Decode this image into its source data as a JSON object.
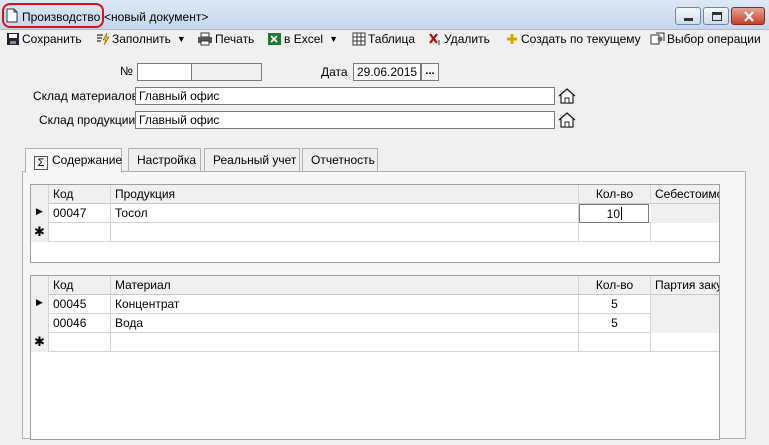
{
  "window": {
    "title": "Производство",
    "subtitle": "<новый документ>"
  },
  "toolbar": {
    "save": "Сохранить",
    "fill": "Заполнить",
    "print": "Печать",
    "excel": "в Excel",
    "table": "Таблица",
    "delete": "Удалить",
    "create_from_current": "Создать по текущему",
    "choose_operation": "Выбор операции"
  },
  "header": {
    "number_label": "№",
    "number_value": "",
    "date_label": "Дата",
    "date_value": "29.06.2015",
    "materials_warehouse_label": "Склад материалов",
    "materials_warehouse_value": "Главный офис",
    "products_warehouse_label": "Склад продукции",
    "products_warehouse_value": "Главный офис"
  },
  "tabs": [
    {
      "label": "Содержание",
      "active": true
    },
    {
      "label": "Настройка"
    },
    {
      "label": "Реальный учет"
    },
    {
      "label": "Отчетность"
    }
  ],
  "products_grid": {
    "columns": [
      "Код",
      "Продукция",
      "Кол-во",
      "Себестоимо"
    ],
    "rows": [
      {
        "code": "00047",
        "name": "Тосол",
        "qty": "10",
        "cost": ""
      }
    ]
  },
  "materials_grid": {
    "columns": [
      "Код",
      "Материал",
      "Кол-во",
      "Партия заку"
    ],
    "rows": [
      {
        "code": "00045",
        "name": "Концентрат",
        "qty": "5",
        "batch": ""
      },
      {
        "code": "00046",
        "name": "Вода",
        "qty": "5",
        "batch": ""
      }
    ]
  },
  "icons": {
    "row_current": "▶",
    "row_new": "✱"
  }
}
